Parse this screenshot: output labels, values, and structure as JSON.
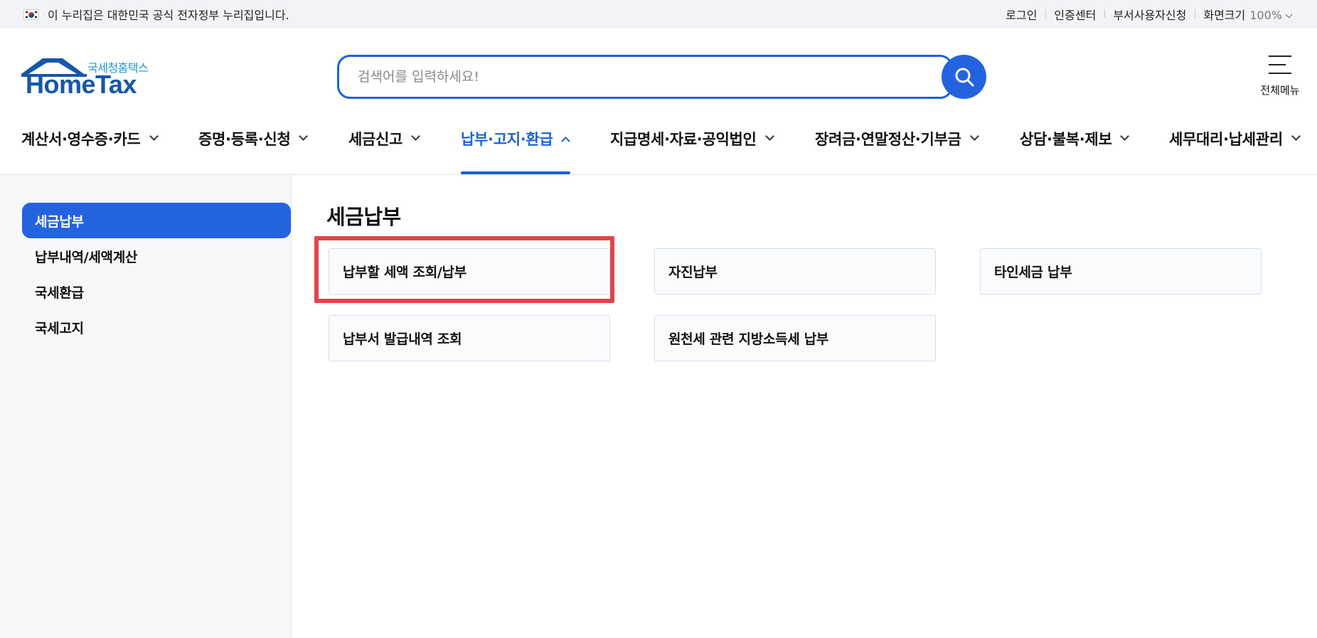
{
  "gov_banner": {
    "text": "이 누리집은 대한민국 공식 전자정부 누리집입니다.",
    "flag_icon": "korea-flag-icon"
  },
  "util_links": {
    "login": "로그인",
    "cert_center": "인증센터",
    "dept_user": "부서사용자신청",
    "zoom_label": "화면크기",
    "zoom_value": "100%"
  },
  "logo": {
    "sub": "국세청홈택스",
    "main": "HomeTax"
  },
  "search": {
    "placeholder": "검색어를 입력하세요!",
    "value": ""
  },
  "all_menu": {
    "label": "전체메뉴"
  },
  "gnb": {
    "items": [
      {
        "label": "계산서·영수증·카드",
        "active": false
      },
      {
        "label": "증명·등록·신청",
        "active": false
      },
      {
        "label": "세금신고",
        "active": false
      },
      {
        "label": "납부·고지·환급",
        "active": true
      },
      {
        "label": "지급명세·자료·공익법인",
        "active": false
      },
      {
        "label": "장려금·연말정산·기부금",
        "active": false
      },
      {
        "label": "상담·불복·제보",
        "active": false
      },
      {
        "label": "세무대리·납세관리",
        "active": false
      }
    ]
  },
  "lnb": {
    "items": [
      {
        "label": "세금납부",
        "selected": true
      },
      {
        "label": "납부내역/세액계산",
        "selected": false
      },
      {
        "label": "국세환급",
        "selected": false
      },
      {
        "label": "국세고지",
        "selected": false
      }
    ]
  },
  "content": {
    "title": "세금납부",
    "cards": [
      {
        "label": "납부할 세액 조회/납부",
        "highlighted": true
      },
      {
        "label": "자진납부",
        "highlighted": false
      },
      {
        "label": "타인세금 납부",
        "highlighted": false
      },
      {
        "label": "납부서 발급내역 조회",
        "highlighted": false
      },
      {
        "label": "원천세 관련 지방소득세 납부",
        "highlighted": false
      }
    ]
  },
  "colors": {
    "primary": "#2463e0",
    "active_text": "#1a62d9",
    "logo_blue": "#1457a8",
    "logo_sub": "#1a9ad6",
    "highlight_red": "#e2454a",
    "topbar_bg": "#f2f3f6",
    "lnb_bg": "#f7f8fa"
  }
}
